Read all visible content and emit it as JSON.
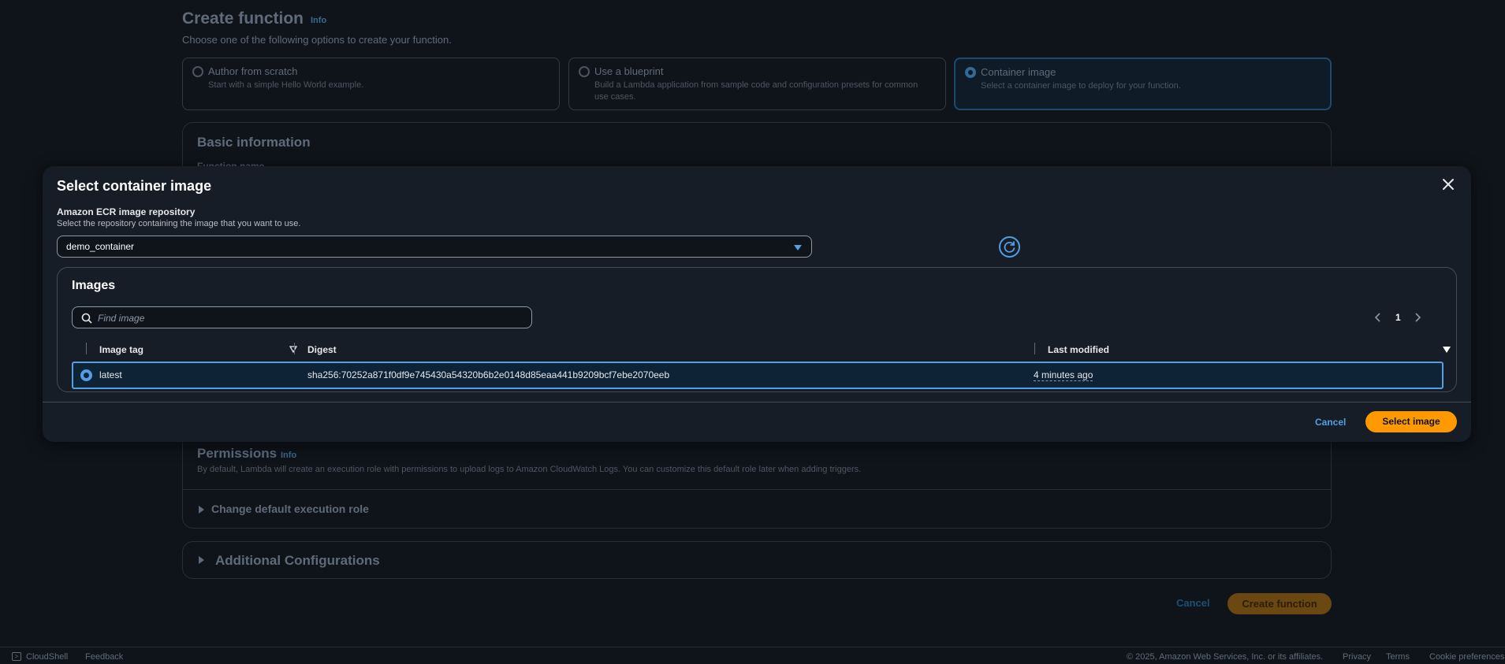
{
  "page": {
    "title": "Create function",
    "info": "Info",
    "subtitle": "Choose one of the following options to create your function.",
    "options": [
      {
        "title": "Author from scratch",
        "desc": "Start with a simple Hello World example."
      },
      {
        "title": "Use a blueprint",
        "desc": "Build a Lambda application from sample code and configuration presets for common use cases."
      },
      {
        "title": "Container image",
        "desc": "Select a container image to deploy for your function."
      }
    ],
    "basic_info": "Basic information",
    "function_name_label": "Function name",
    "permissions": "Permissions",
    "permissions_info": "Info",
    "permissions_desc": "By default, Lambda will create an execution role with permissions to upload logs to Amazon CloudWatch Logs. You can customize this default role later when adding triggers.",
    "change_role": "Change default execution role",
    "additional": "Additional Configurations",
    "cancel": "Cancel",
    "create": "Create function"
  },
  "footer": {
    "cloudshell": "CloudShell",
    "feedback": "Feedback",
    "copyright": "© 2025, Amazon Web Services, Inc. or its affiliates.",
    "privacy": "Privacy",
    "terms": "Terms",
    "cookies": "Cookie preferences"
  },
  "modal": {
    "title": "Select container image",
    "repo_label": "Amazon ECR image repository",
    "repo_desc": "Select the repository containing the image that you want to use.",
    "repo_value": "demo_container",
    "images_heading": "Images",
    "search_placeholder": "Find image",
    "page_number": "1",
    "columns": {
      "tag": "Image tag",
      "digest": "Digest",
      "modified": "Last modified"
    },
    "rows": [
      {
        "tag": "latest",
        "digest": "sha256:70252a871f0df9e745430a54320b6b2e0148d85eaa441b9209bcf7ebe2070eeb",
        "modified": "4 minutes ago",
        "selected": true
      }
    ],
    "cancel": "Cancel",
    "confirm": "Select image"
  },
  "colors": {
    "accent": "#539fe5",
    "primary": "#ff9900",
    "bg": "#0f141a",
    "modal_bg": "#161d26"
  }
}
